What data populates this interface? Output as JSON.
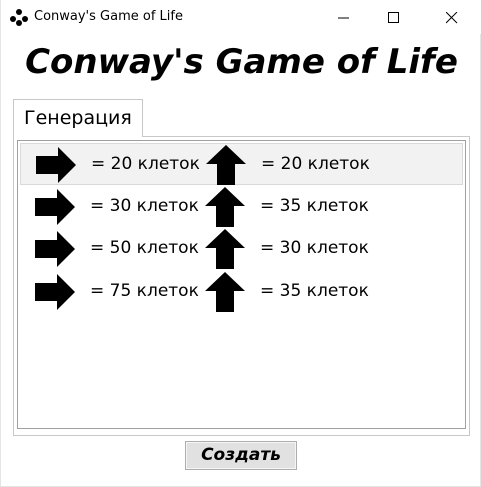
{
  "window": {
    "title": "Conway's Game of Life",
    "icon": "dots-logo-icon",
    "controls": [
      "minimize-icon",
      "maximize-icon",
      "close-icon"
    ]
  },
  "heading": "Conway's Game of Life",
  "tabs": [
    {
      "label": "Генерация",
      "selected": true
    }
  ],
  "sizes": [
    {
      "width": "= 20 клеток",
      "height": "= 20 клеток",
      "selected": true
    },
    {
      "width": "= 30 клеток",
      "height": "= 35 клеток",
      "selected": false
    },
    {
      "width": "= 50 клеток",
      "height": "= 30 клеток",
      "selected": false
    },
    {
      "width": "= 75 клеток",
      "height": "= 35 клеток",
      "selected": false
    }
  ],
  "width_icon": "arrow-right-icon",
  "height_icon": "arrow-up-icon",
  "create_button": "Создать",
  "colors": {
    "selected_row": "#f2f2f2",
    "button_bg": "#e1e1e1",
    "border": "#a0a0a0"
  }
}
